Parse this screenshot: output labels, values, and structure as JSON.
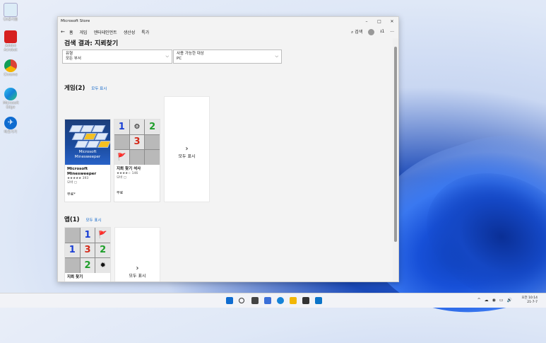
{
  "desktop": {
    "icons": [
      {
        "name": "recycle-bin-icon",
        "label": "Ǔƛ휴지통",
        "color": "#dcecf7"
      },
      {
        "name": "acrobat-icon",
        "label": "Adobe Acrobat",
        "color": "#d62020"
      },
      {
        "name": "chrome-icon",
        "label": "Chrome",
        "color": "#2aa34a"
      },
      {
        "name": "edge-icon",
        "label": "Microsoft Edge",
        "color": "#1583d8"
      },
      {
        "name": "app-icon",
        "label": "바로가기",
        "color": "#0f6cd0"
      }
    ]
  },
  "window": {
    "title": "Microsoft Store",
    "controls": {
      "minimize": "–",
      "maximize": "□",
      "close": "✕"
    },
    "nav": {
      "back": "←",
      "items": [
        "홈",
        "게임",
        "엔터테인먼트",
        "생산성",
        "특가"
      ],
      "search_label": "검색",
      "download_count": "1",
      "more": "···"
    },
    "page_title": "검색 결과: 지뢰찾기",
    "filters": [
      {
        "label": "유형",
        "value": "모든 부서"
      },
      {
        "label": "사용 가능한 대상",
        "value": "PC"
      }
    ],
    "games_section": {
      "title": "게임",
      "count": "(2)",
      "show_all": "모두 표시",
      "cards": [
        {
          "name_line1": "Microsoft",
          "name_line2": "Minesweeper",
          "rating": "★★★★★ 393",
          "badge": "모바 ▢",
          "price": "무료*",
          "image_line1": "Microsoft",
          "image_line2": "Minesweeper"
        },
        {
          "name_line1": "지뢰 찾기 석사",
          "name_line2": "",
          "rating": "★★★★☆ 146",
          "badge": "모바 ▢",
          "price": "무료"
        }
      ],
      "more_label": "모두 표시"
    },
    "apps_section": {
      "title": "앱",
      "count": "(1)",
      "show_all": "모두 표시",
      "cards": [
        {
          "name": "지뢰 찾기"
        }
      ],
      "more_label": "모두 표시"
    },
    "board_game": {
      "cells": [
        "1",
        "⚙",
        "2",
        "",
        "3",
        "",
        "🚩",
        "",
        ""
      ]
    },
    "board_app": {
      "cells": [
        "",
        "1",
        "🚩",
        "1",
        "3",
        "2",
        "",
        "2",
        "✹"
      ]
    }
  },
  "taskbar": {
    "tray_icons": [
      "^",
      "☁",
      "◉",
      "▭",
      "🔊"
    ],
    "ime": "A",
    "time_line1": "오전 10:14",
    "time_line2": "21-7-7"
  },
  "colors": {
    "accent": "#0a63c9"
  }
}
